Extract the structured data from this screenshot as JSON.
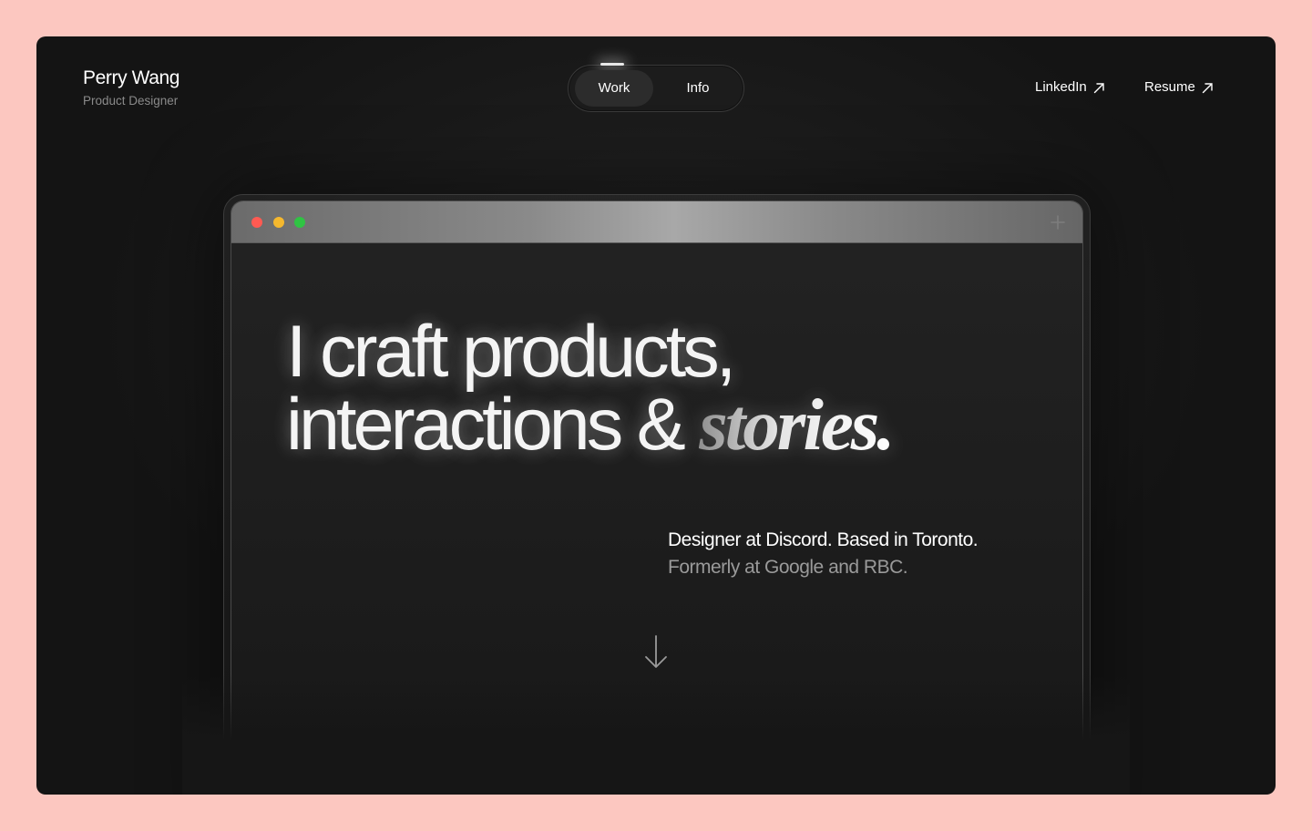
{
  "header": {
    "name": "Perry Wang",
    "role": "Product Designer"
  },
  "nav": {
    "tabs": [
      {
        "label": "Work",
        "active": true
      },
      {
        "label": "Info",
        "active": false
      }
    ]
  },
  "links": {
    "linkedin": "LinkedIn",
    "resume": "Resume"
  },
  "hero": {
    "line1": "I craft products,",
    "line2_plain": "interactions & ",
    "line2_italic": "stories."
  },
  "bio": {
    "line1": "Designer at Discord. Based in Toronto.",
    "line2": "Formerly at Google and RBC."
  },
  "browser": {
    "traffic_lights": [
      "#ff5a52",
      "#f5b82e",
      "#2fc443"
    ],
    "new_tab_icon": "plus-icon"
  },
  "colors": {
    "page_background": "#fcc7c0",
    "frame_background": "#1b1b1b",
    "text_primary": "#ffffff",
    "text_secondary": "#9a9a9a"
  }
}
